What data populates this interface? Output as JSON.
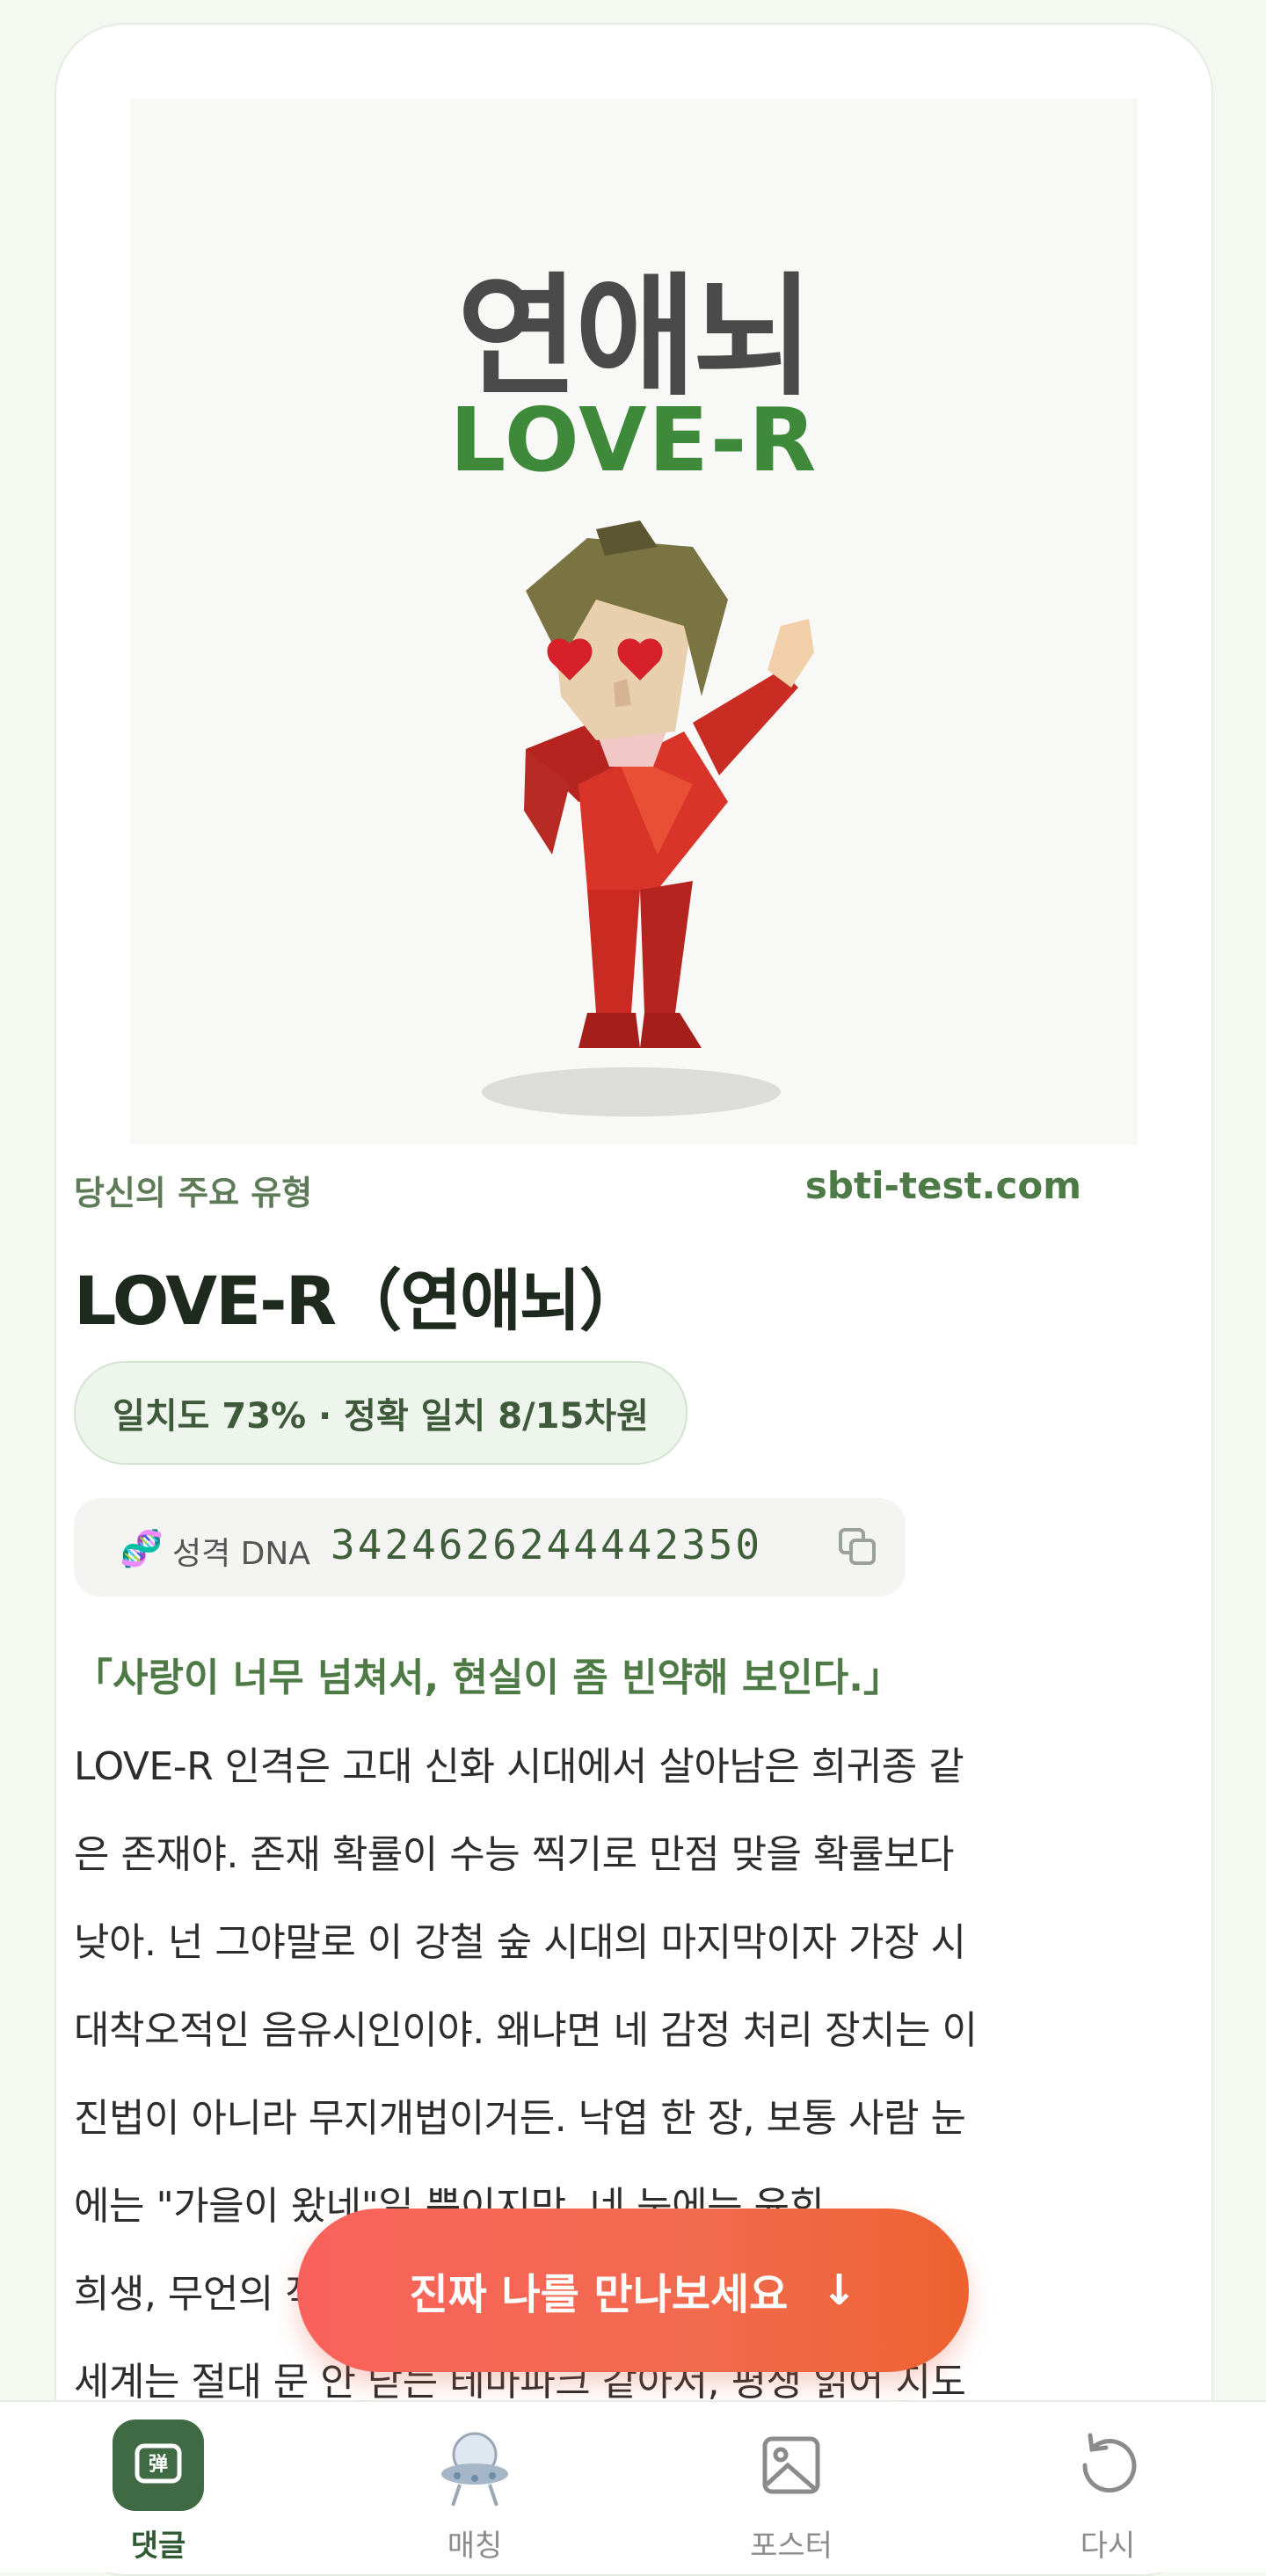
{
  "hero": {
    "title": "연애뇌",
    "code": "LOVE-R"
  },
  "result": {
    "label": "당신의 주요 유형",
    "site": "sbti-test.com",
    "type_title": "LOVE-R（연애뇌）",
    "match": "일치도 73% · 정확 일치 8/15차원",
    "dna_label": "성격 DNA",
    "dna_value": "3424626244442350",
    "quote": "「사랑이 너무 넘쳐서, 현실이 좀 빈약해 보인다.」",
    "body_lines": [
      "LOVE-R 인격은 고대 신화 시대에서 살아남은 희귀종 같",
      "은 존재야. 존재 확률이 수능 찍기로 만점 맞을 확률보다",
      "낮아. 넌 그야말로 이 강철 숲 시대의 마지막이자 가장 시",
      "대착오적인 음유시인이야. 왜냐면 네 감정 처리 장치는 이",
      "진법이 아니라 무지개법이거든. 낙엽 한 장, 보통 사람 눈",
      "에는 \"가을이 왔네\"일 뿐이지만, 네 눈에는 윤회,",
      "희생, 무언의 작별 같은 거대한 서사야. 네 내면",
      "세계는 절대 문 안 닫는 테마파크 같아서, 평생 읽어 지도"
    ]
  },
  "cta": {
    "label": "진짜 나를 만나보세요",
    "arrow": "↓"
  },
  "tabs": [
    {
      "label": "댓글",
      "icon": "comment-icon",
      "active": true
    },
    {
      "label": "매칭",
      "icon": "ufo-icon",
      "active": false
    },
    {
      "label": "포스터",
      "icon": "image-icon",
      "active": false
    },
    {
      "label": "다시",
      "icon": "refresh-icon",
      "active": false
    }
  ],
  "colors": {
    "accent_green": "#3f8a3a",
    "cta_start": "#f9625c",
    "cta_end": "#ee6230",
    "tab_active": "#3f6a44"
  }
}
